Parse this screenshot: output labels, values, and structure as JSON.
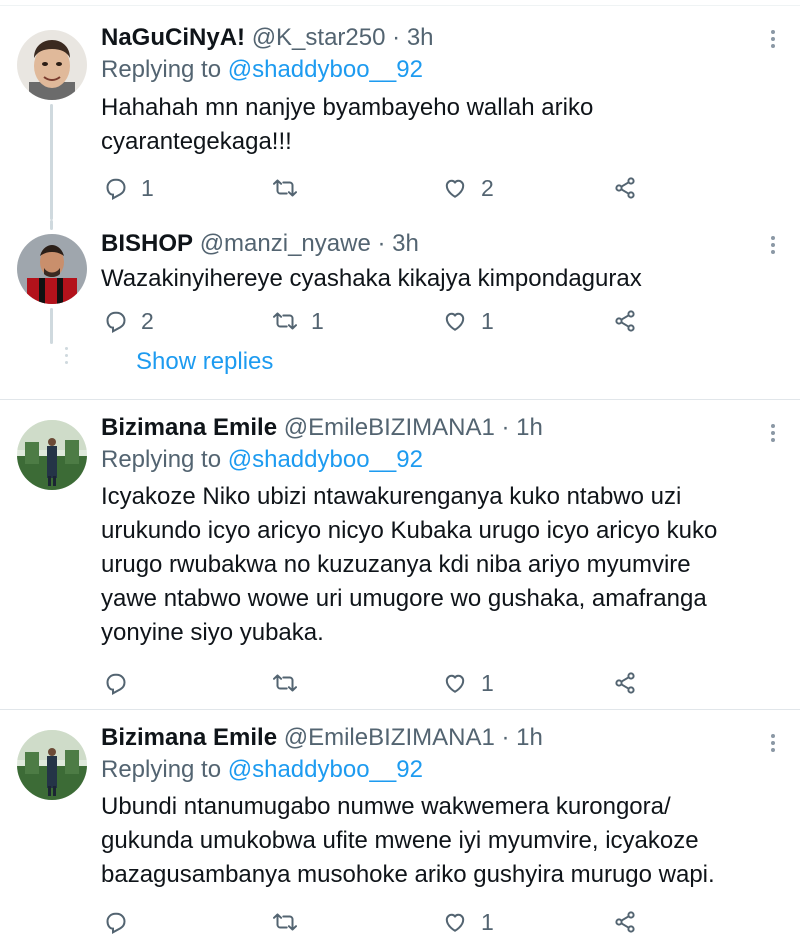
{
  "tweets": [
    {
      "name": "NaGuCiNyA!",
      "handle": "@K_star250",
      "time": "3h",
      "replying_prefix": "Replying to",
      "replying_to": "@shaddyboo__92",
      "text": "Hahahah mn nanjye byambayeho wallah ariko cyarantegekaga!!!",
      "replies": "1",
      "retweets": "",
      "likes": "2"
    },
    {
      "name": "BISHOP",
      "handle": "@manzi_nyawe",
      "time": "3h",
      "text": "Wazakinyihereye cyashaka kikajya kimpondagurax",
      "replies": "2",
      "retweets": "1",
      "likes": "1"
    },
    {
      "name": "Bizimana Emile",
      "handle": "@EmileBIZIMANA1",
      "time": "1h",
      "replying_prefix": "Replying to",
      "replying_to": "@shaddyboo__92",
      "text": "Icyakoze Niko ubizi ntawakurenganya kuko ntabwo uzi urukundo icyo aricyo nicyo Kubaka urugo icyo aricyo kuko urugo rwubakwa no kuzuzanya kdi niba ariyo myumvire yawe ntabwo wowe uri umugore wo gushaka, amafranga yonyine siyo yubaka.",
      "replies": "",
      "retweets": "",
      "likes": "1"
    },
    {
      "name": "Bizimana Emile",
      "handle": "@EmileBIZIMANA1",
      "time": "1h",
      "replying_prefix": "Replying to",
      "replying_to": "@shaddyboo__92",
      "text": "Ubundi ntanumugabo numwe wakwemera kurongora/ gukunda umukobwa ufite mwene iyi myumvire, icyakoze bazagusambanya musohoke ariko gushyira murugo wapi.",
      "replies": "",
      "retweets": "",
      "likes": "1"
    }
  ],
  "show_replies_label": "Show replies",
  "colors": {
    "accent": "#1d9bf0",
    "secondary_text": "#536471",
    "divider": "#e1e6ea"
  },
  "icons": [
    "reply-icon",
    "retweet-icon",
    "like-icon",
    "share-icon",
    "more-icon"
  ]
}
